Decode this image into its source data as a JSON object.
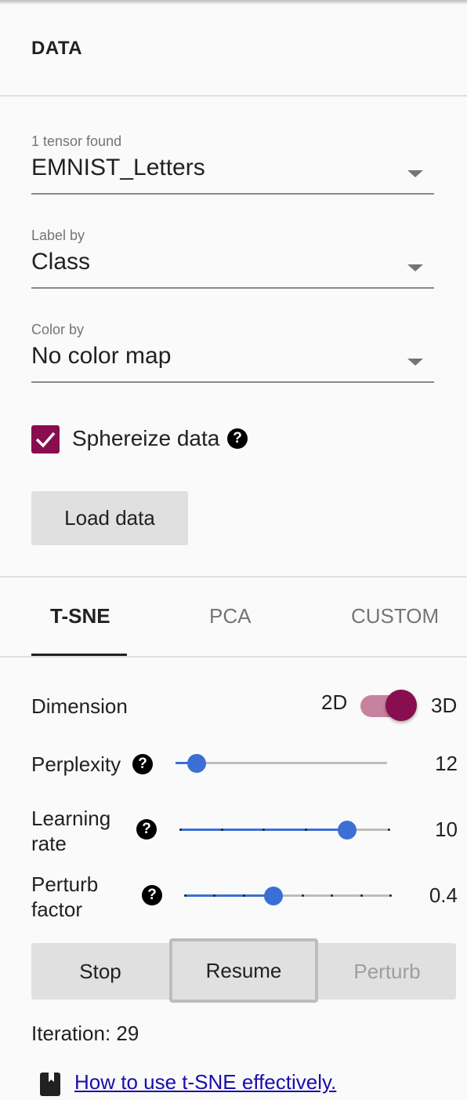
{
  "header": {
    "title": "DATA"
  },
  "tensor": {
    "label": "1 tensor found",
    "value": "EMNIST_Letters"
  },
  "label_by": {
    "label": "Label by",
    "value": "Class"
  },
  "color_by": {
    "label": "Color by",
    "value": "No color map"
  },
  "spherize": {
    "label": "Sphereize data",
    "checked": true,
    "help": "?"
  },
  "load_button": "Load data",
  "tabs": [
    {
      "label": "T-SNE",
      "active": true
    },
    {
      "label": "PCA",
      "active": false
    },
    {
      "label": "CUSTOM",
      "active": false
    }
  ],
  "dimension": {
    "label": "Dimension",
    "left": "2D",
    "right": "3D",
    "selected": "3D"
  },
  "perplexity": {
    "label": "Perplexity",
    "value": "12",
    "help": "?",
    "fraction": 0.1
  },
  "learning_rate": {
    "label_line1": "Learning",
    "label_line2": "rate",
    "value": "10",
    "help": "?",
    "fraction": 0.8
  },
  "perturb": {
    "label_line1": "Perturb",
    "label_line2": "factor",
    "value": "0.4",
    "help": "?",
    "fraction": 0.43
  },
  "actions": {
    "stop": "Stop",
    "resume": "Resume",
    "perturb": "Perturb"
  },
  "iteration": "Iteration: 29",
  "help_link": {
    "text": "How to use t-SNE effectively.",
    "icon": "book-icon"
  },
  "colors": {
    "accent": "#880e4f",
    "slider": "#3b6fd6",
    "link": "#1a0dab"
  }
}
